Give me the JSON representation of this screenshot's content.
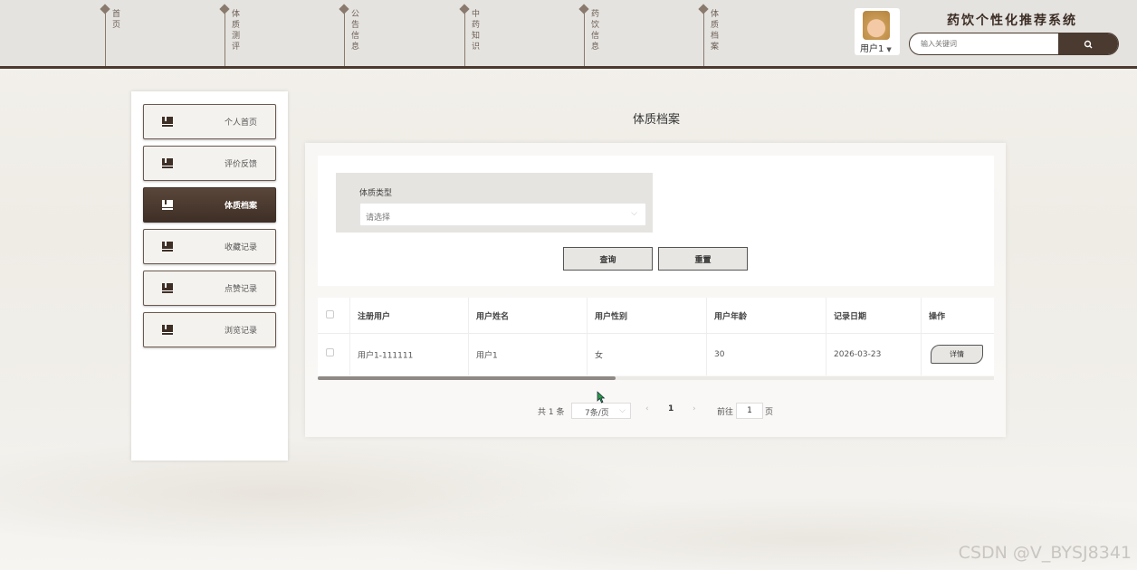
{
  "header": {
    "nav": [
      {
        "label": "首页"
      },
      {
        "label": "体质测评"
      },
      {
        "label": "公告信息"
      },
      {
        "label": "中药知识"
      },
      {
        "label": "药饮信息"
      },
      {
        "label": "体质档案"
      }
    ],
    "user_name": "用户1",
    "site_title": "药饮个性化推荐系统",
    "search_placeholder": "输入关键词",
    "search_icon": "search-icon"
  },
  "sidebar": {
    "items": [
      {
        "label": "个人首页",
        "icon": "book-icon",
        "active": false
      },
      {
        "label": "评价反馈",
        "icon": "book-icon",
        "active": false
      },
      {
        "label": "体质档案",
        "icon": "book-icon",
        "active": true
      },
      {
        "label": "收藏记录",
        "icon": "book-icon",
        "active": false
      },
      {
        "label": "点赞记录",
        "icon": "book-icon",
        "active": false
      },
      {
        "label": "浏览记录",
        "icon": "book-icon",
        "active": false
      }
    ]
  },
  "main": {
    "title": "体质档案",
    "filter": {
      "label": "体质类型",
      "placeholder": "请选择"
    },
    "buttons": {
      "query": "查询",
      "reset": "重置"
    },
    "table": {
      "columns": [
        "注册用户",
        "用户姓名",
        "用户性别",
        "用户年龄",
        "记录日期",
        "操作"
      ],
      "rows": [
        {
          "user": "用户1-111111",
          "name": "用户1",
          "gender": "女",
          "age": "30",
          "date": "2026-03-23",
          "action": "详情"
        }
      ]
    },
    "pagination": {
      "total": "共 1 条",
      "page_size": "7条/页",
      "current": "1",
      "goto_label": "前往",
      "goto_value": "1",
      "goto_unit": "页"
    }
  },
  "watermark": "CSDN @V_BYSJ8341",
  "colors": {
    "accent": "#4a3a30",
    "header_bg": "#e5e3df"
  }
}
